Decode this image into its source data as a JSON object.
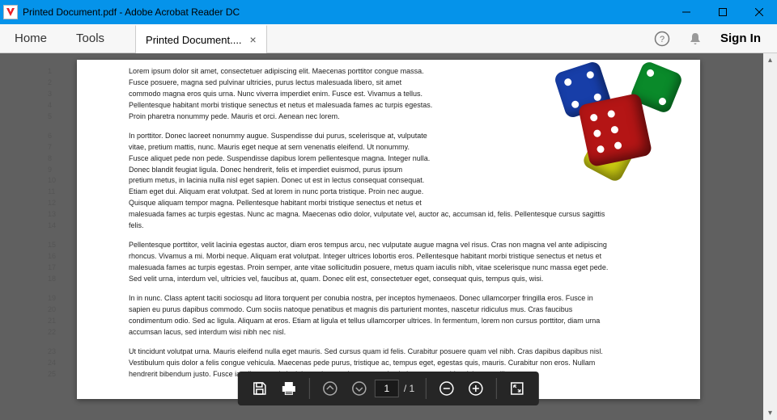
{
  "window": {
    "title": "Printed Document.pdf - Adobe Acrobat Reader DC"
  },
  "toolbar": {
    "home": "Home",
    "tools": "Tools",
    "tab_label": "Printed Document....",
    "signin": "Sign In"
  },
  "footer": {
    "page_current": "1",
    "page_separator": "/",
    "page_total": "1"
  },
  "lines": [
    "Lorem ipsum dolor sit amet, consectetuer adipiscing elit. Maecenas porttitor congue massa.",
    "Fusce posuere, magna sed pulvinar ultricies, purus lectus malesuada libero, sit amet",
    "commodo magna eros quis urna. Nunc viverra imperdiet enim. Fusce est. Vivamus a tellus.",
    "Pellentesque habitant morbi tristique senectus et netus et malesuada fames ac turpis egestas.",
    "Proin pharetra nonummy pede. Mauris et orci. Aenean nec lorem.",
    "",
    "In porttitor. Donec laoreet nonummy augue. Suspendisse dui purus, scelerisque at, vulputate",
    "vitae, pretium mattis, nunc. Mauris eget neque at sem venenatis eleifend. Ut nonummy.",
    "Fusce aliquet pede non pede. Suspendisse dapibus lorem pellentesque magna. Integer nulla.",
    "Donec blandit feugiat ligula. Donec hendrerit, felis et imperdiet euismod, purus ipsum",
    "pretium metus, in lacinia nulla nisl eget sapien. Donec ut est in lectus consequat consequat.",
    "Etiam eget dui. Aliquam erat volutpat. Sed at lorem in nunc porta tristique. Proin nec augue.",
    "Quisque aliquam tempor magna. Pellentesque habitant morbi tristique senectus et netus et",
    "malesuada fames ac turpis egestas. Nunc ac magna. Maecenas odio dolor, vulputate vel, auctor ac, accumsan id, felis. Pellentesque cursus sagittis",
    "felis.",
    "",
    "Pellentesque porttitor, velit lacinia egestas auctor, diam eros tempus arcu, nec vulputate augue magna vel risus. Cras non magna vel ante adipiscing",
    "rhoncus. Vivamus a mi. Morbi neque. Aliquam erat volutpat. Integer ultrices lobortis eros. Pellentesque habitant morbi tristique senectus et netus et",
    "malesuada fames ac turpis egestas. Proin semper, ante vitae sollicitudin posuere, metus quam iaculis nibh, vitae scelerisque nunc massa eget pede.",
    "Sed velit urna, interdum vel, ultricies vel, faucibus at, quam. Donec elit est, consectetuer eget, consequat quis, tempus quis, wisi.",
    "",
    "In in nunc. Class aptent taciti sociosqu ad litora torquent per conubia nostra, per inceptos hymenaeos. Donec ullamcorper fringilla eros. Fusce in",
    "sapien eu purus dapibus commodo. Cum sociis natoque penatibus et magnis dis parturient montes, nascetur ridiculus mus. Cras faucibus",
    "condimentum odio. Sed ac ligula. Aliquam at eros. Etiam at ligula et tellus ullamcorper ultrices. In fermentum, lorem non cursus porttitor, diam urna",
    "accumsan lacus, sed interdum wisi nibh nec nisl.",
    "",
    "Ut tincidunt volutpat urna. Mauris eleifend nulla eget mauris. Sed cursus quam id felis. Curabitur posuere quam vel nibh. Cras dapibus dapibus nisl.",
    "Vestibulum quis dolor a felis congue vehicula. Maecenas pede purus, tristique ac, tempus eget, egestas quis, mauris. Curabitur non eros. Nullam",
    "hendrerit bibendum justo. Fusce iaculis, est quis lacinia pretium, pede metus molestie lacus, at gravida wisi ante at libero."
  ]
}
